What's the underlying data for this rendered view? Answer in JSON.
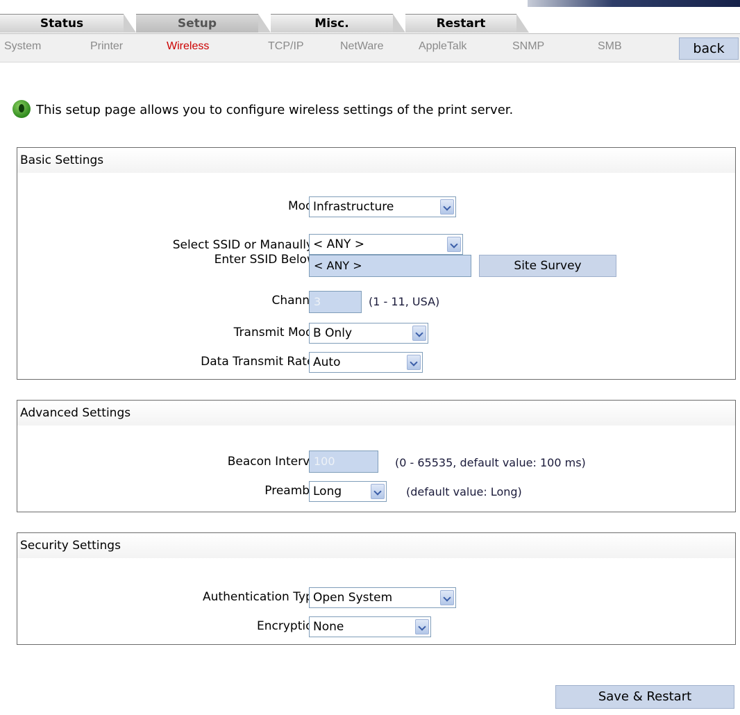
{
  "tabs": [
    "Status",
    "Setup",
    "Misc.",
    "Restart"
  ],
  "active_tab": "Setup",
  "subnav": [
    "System",
    "Printer",
    "Wireless",
    "TCP/IP",
    "NetWare",
    "AppleTalk",
    "SNMP",
    "SMB"
  ],
  "active_subnav": "Wireless",
  "back_label": "back",
  "intro": "This setup page allows you to configure wireless settings of the print server.",
  "basic": {
    "title": "Basic Settings",
    "mode_label": "Mode:",
    "mode_value": "Infrastructure",
    "ssid_label_line1": "Select SSID or Manaully",
    "ssid_label_line2": "Enter SSID Below :",
    "ssid_select_value": "< ANY >",
    "ssid_input_value": "< ANY >",
    "site_survey_label": "Site Survey",
    "channel_label": "Channel:",
    "channel_value": "3",
    "channel_hint": "(1 - 11, USA)",
    "transmit_mode_label": "Transmit Mode:",
    "transmit_mode_value": "B Only",
    "data_rates_label": "Data Transmit Rates:",
    "data_rates_value": "Auto"
  },
  "advanced": {
    "title": "Advanced Settings",
    "beacon_label": "Beacon Interval:",
    "beacon_value": "100",
    "beacon_hint": "(0 - 65535, default value: 100 ms)",
    "preamble_label": "Preamble:",
    "preamble_value": "Long",
    "preamble_hint": "(default value: Long)"
  },
  "security": {
    "title": "Security Settings",
    "auth_label": "Authentication Type:",
    "auth_value": "Open System",
    "encryption_label": "Encryption:",
    "encryption_value": "None"
  },
  "save_label": "Save & Restart",
  "icons": {
    "intro_icon": "green-info-icon",
    "dropdown": "chevron-down-icon"
  }
}
